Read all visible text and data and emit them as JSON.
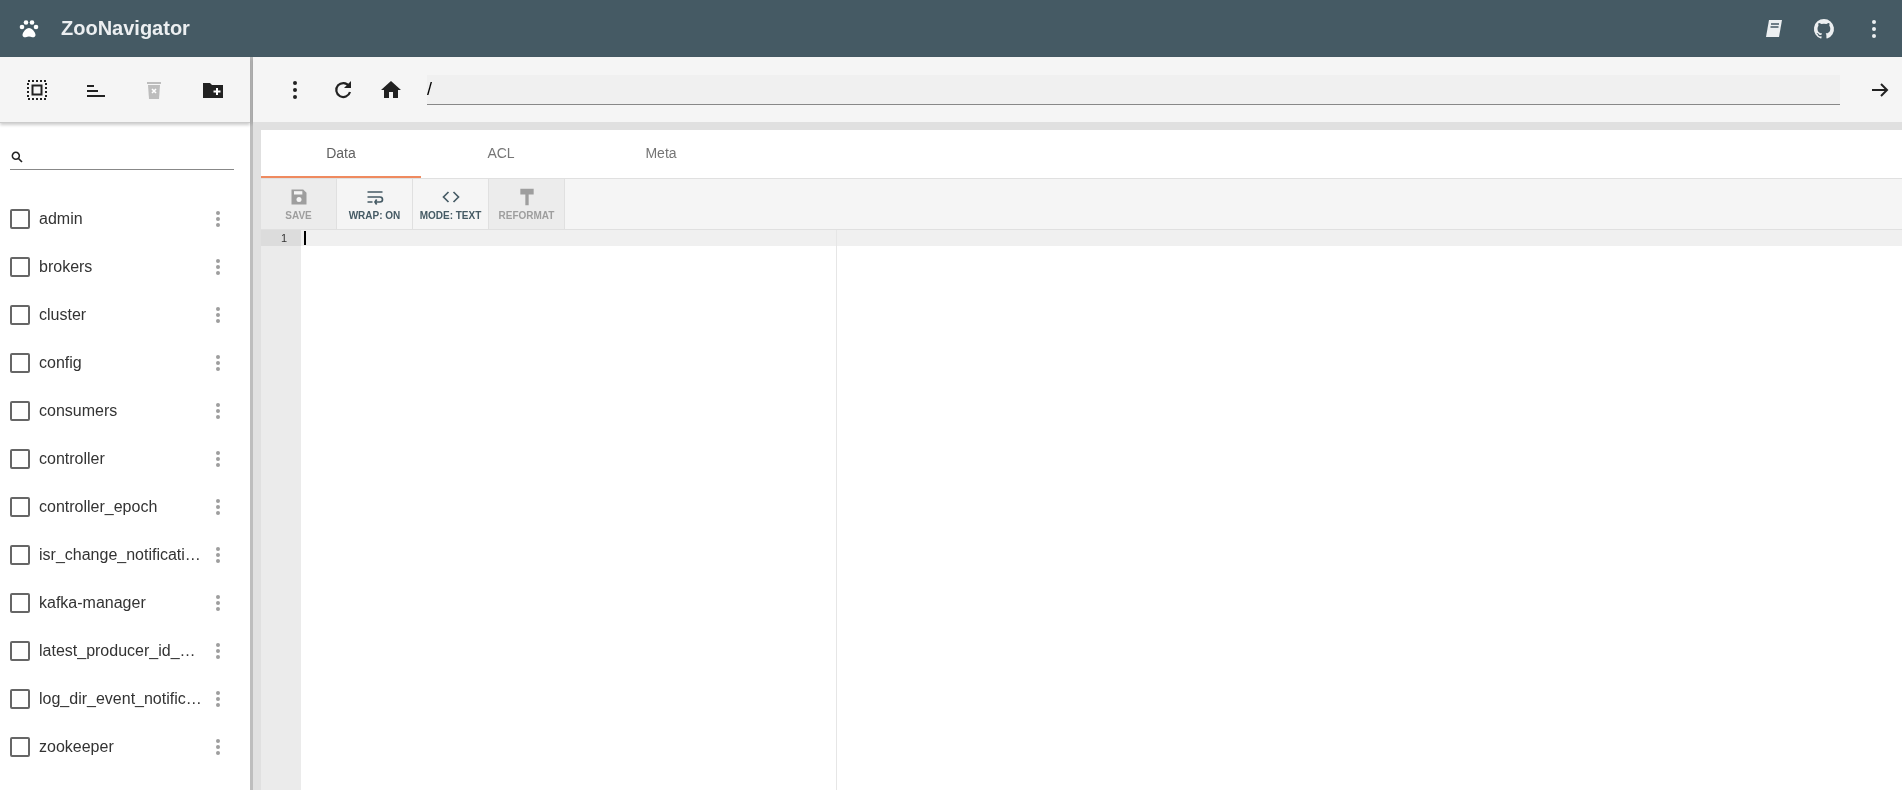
{
  "app_bar": {
    "title": "ZooNavigator"
  },
  "sidebar": {
    "items": [
      {
        "label": "admin",
        "checked": false
      },
      {
        "label": "brokers",
        "checked": false
      },
      {
        "label": "cluster",
        "checked": false
      },
      {
        "label": "config",
        "checked": false
      },
      {
        "label": "consumers",
        "checked": false
      },
      {
        "label": "controller",
        "checked": false
      },
      {
        "label": "controller_epoch",
        "checked": false
      },
      {
        "label": "isr_change_notificati…",
        "checked": false
      },
      {
        "label": "kafka-manager",
        "checked": false
      },
      {
        "label": "latest_producer_id_…",
        "checked": false
      },
      {
        "label": "log_dir_event_notific…",
        "checked": false
      },
      {
        "label": "zookeeper",
        "checked": false
      }
    ]
  },
  "path_bar": {
    "value": "/"
  },
  "tabs": [
    {
      "label": "Data",
      "selected": true
    },
    {
      "label": "ACL",
      "selected": false
    },
    {
      "label": "Meta",
      "selected": false
    }
  ],
  "editor_toolbar": [
    {
      "kind": "save",
      "label": "SAVE",
      "disabled": true
    },
    {
      "kind": "wrap",
      "label": "WRAP: ON",
      "disabled": false
    },
    {
      "kind": "mode",
      "label": "MODE: TEXT",
      "disabled": false
    },
    {
      "kind": "reformat",
      "label": "REFORMAT",
      "disabled": true
    }
  ],
  "editor": {
    "line_numbers": [
      "1"
    ]
  }
}
